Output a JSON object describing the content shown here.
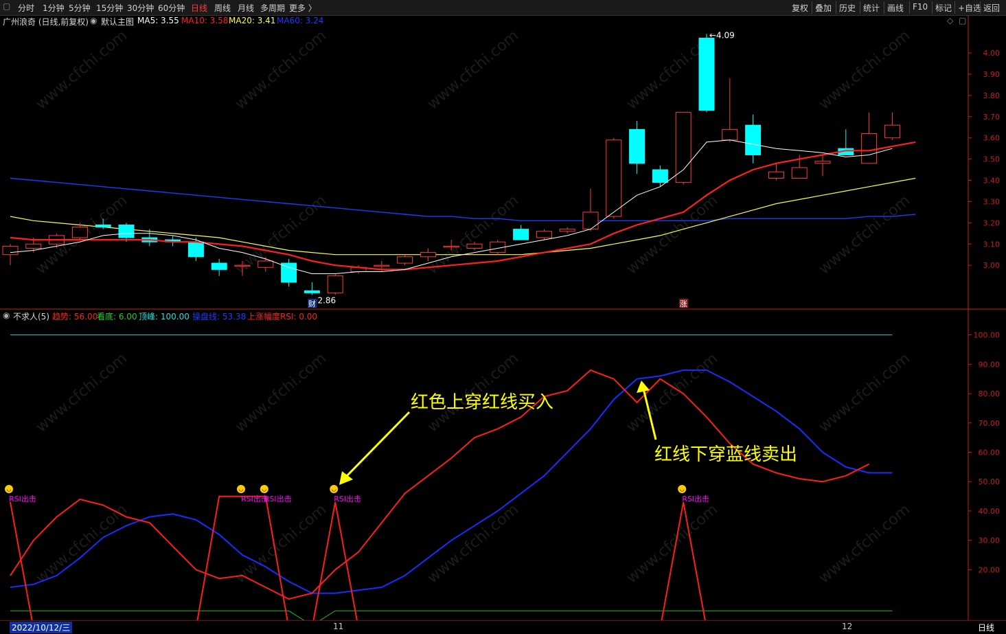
{
  "toolbar": {
    "left": [
      "分时",
      "1分钟",
      "5分钟",
      "15分钟",
      "30分钟",
      "60分钟",
      "日线",
      "周线",
      "月线",
      "多周期",
      "更多 〉"
    ],
    "active": "日线",
    "right": [
      "复权",
      "叠加",
      "历史",
      "统计",
      "画线",
      "F10",
      "标记",
      "+自选",
      "返回"
    ]
  },
  "main_header": {
    "stock": "广州浪奇 (日线,前复权)",
    "template": "默认主图",
    "ma5": "MA5: 3.55",
    "ma10": "MA10: 3.58",
    "ma20": "MA20: 3.41",
    "ma60": "MA60: 3.24"
  },
  "indicator_header": {
    "name": "不求人(5)",
    "trend": "趋势: 56.00",
    "bottom": "看底: 6.00",
    "top": "顶峰: 100.00",
    "swing": "操盘线: 53.38",
    "rsi": "上涨幅度RSI: 0.00"
  },
  "annotations": {
    "buy": "红色上穿红线买入",
    "sell": "红线下穿蓝线卖出",
    "rsi_signal": "RSI出击",
    "high_label": "4.09",
    "low_label": "2.86",
    "marker_cai": "财",
    "marker_zhang": "涨"
  },
  "bottom": {
    "date": "2022/10/12/三",
    "month11": "11",
    "month12": "12",
    "period": "日线"
  },
  "colors": {
    "up": "#ff3b3b",
    "down": "#00ffff",
    "ma5": "#ffffff",
    "ma10": "#ff2020",
    "ma20": "#ffff40",
    "ma60": "#1a3cff",
    "axis": "#c81e1e",
    "annotation": "#ffff00",
    "rsi_text": "#ff00ff"
  },
  "chart_data": [
    {
      "type": "candlestick",
      "title": "广州浪奇 (日线,前复权)",
      "y_ticks": [
        3.0,
        3.1,
        3.2,
        3.3,
        3.4,
        3.5,
        3.6,
        3.7,
        3.8,
        3.9,
        4.0
      ],
      "ylim": [
        2.8,
        4.12
      ],
      "candles": [
        {
          "o": 3.05,
          "h": 3.1,
          "l": 3.0,
          "c": 3.09
        },
        {
          "o": 3.08,
          "h": 3.13,
          "l": 3.06,
          "c": 3.1
        },
        {
          "o": 3.1,
          "h": 3.15,
          "l": 3.08,
          "c": 3.14
        },
        {
          "o": 3.13,
          "h": 3.2,
          "l": 3.12,
          "c": 3.18
        },
        {
          "o": 3.19,
          "h": 3.22,
          "l": 3.17,
          "c": 3.18
        },
        {
          "o": 3.19,
          "h": 3.2,
          "l": 3.11,
          "c": 3.13
        },
        {
          "o": 3.13,
          "h": 3.17,
          "l": 3.09,
          "c": 3.11
        },
        {
          "o": 3.12,
          "h": 3.14,
          "l": 3.09,
          "c": 3.11
        },
        {
          "o": 3.11,
          "h": 3.13,
          "l": 3.02,
          "c": 3.04
        },
        {
          "o": 3.01,
          "h": 3.03,
          "l": 2.95,
          "c": 2.98
        },
        {
          "o": 3.0,
          "h": 3.02,
          "l": 2.95,
          "c": 3.0
        },
        {
          "o": 2.99,
          "h": 3.04,
          "l": 2.97,
          "c": 3.02
        },
        {
          "o": 3.01,
          "h": 3.03,
          "l": 2.9,
          "c": 2.92
        },
        {
          "o": 2.88,
          "h": 2.92,
          "l": 2.86,
          "c": 2.87
        },
        {
          "o": 2.87,
          "h": 2.96,
          "l": 2.86,
          "c": 2.95
        },
        {
          "o": 2.97,
          "h": 3.0,
          "l": 2.96,
          "c": 2.99
        },
        {
          "o": 3.0,
          "h": 3.02,
          "l": 2.97,
          "c": 3.0
        },
        {
          "o": 3.01,
          "h": 3.05,
          "l": 3.0,
          "c": 3.04
        },
        {
          "o": 3.04,
          "h": 3.08,
          "l": 3.02,
          "c": 3.06
        },
        {
          "o": 3.09,
          "h": 3.12,
          "l": 3.07,
          "c": 3.09
        },
        {
          "o": 3.08,
          "h": 3.11,
          "l": 3.07,
          "c": 3.1
        },
        {
          "o": 3.06,
          "h": 3.12,
          "l": 3.05,
          "c": 3.11
        },
        {
          "o": 3.17,
          "h": 3.19,
          "l": 3.12,
          "c": 3.12
        },
        {
          "o": 3.13,
          "h": 3.17,
          "l": 3.12,
          "c": 3.16
        },
        {
          "o": 3.16,
          "h": 3.18,
          "l": 3.15,
          "c": 3.17
        },
        {
          "o": 3.17,
          "h": 3.36,
          "l": 3.16,
          "c": 3.25
        },
        {
          "o": 3.23,
          "h": 3.6,
          "l": 3.22,
          "c": 3.59
        },
        {
          "o": 3.64,
          "h": 3.68,
          "l": 3.43,
          "c": 3.48
        },
        {
          "o": 3.45,
          "h": 3.47,
          "l": 3.37,
          "c": 3.39
        },
        {
          "o": 3.39,
          "h": 3.72,
          "l": 3.38,
          "c": 3.72
        },
        {
          "o": 4.07,
          "h": 4.09,
          "l": 3.72,
          "c": 3.73
        },
        {
          "o": 3.59,
          "h": 3.88,
          "l": 3.58,
          "c": 3.64
        },
        {
          "o": 3.66,
          "h": 3.71,
          "l": 3.48,
          "c": 3.52
        },
        {
          "o": 3.41,
          "h": 3.48,
          "l": 3.4,
          "c": 3.44
        },
        {
          "o": 3.41,
          "h": 3.52,
          "l": 3.41,
          "c": 3.46
        },
        {
          "o": 3.48,
          "h": 3.52,
          "l": 3.42,
          "c": 3.49
        },
        {
          "o": 3.55,
          "h": 3.64,
          "l": 3.53,
          "c": 3.52
        },
        {
          "o": 3.48,
          "h": 3.72,
          "l": 3.48,
          "c": 3.62
        },
        {
          "o": 3.6,
          "h": 3.72,
          "l": 3.59,
          "c": 3.66
        }
      ],
      "ma5": [
        3.06,
        3.07,
        3.09,
        3.11,
        3.14,
        3.15,
        3.15,
        3.14,
        3.12,
        3.08,
        3.06,
        3.03,
        2.99,
        2.96,
        2.96,
        2.97,
        2.97,
        2.98,
        3.01,
        3.04,
        3.06,
        3.08,
        3.1,
        3.12,
        3.14,
        3.17,
        3.25,
        3.33,
        3.37,
        3.45,
        3.58,
        3.59,
        3.57,
        3.55,
        3.54,
        3.53,
        3.51,
        3.52,
        3.55
      ],
      "ma10": [
        3.13,
        3.12,
        3.12,
        3.12,
        3.12,
        3.12,
        3.12,
        3.11,
        3.11,
        3.1,
        3.09,
        3.07,
        3.05,
        3.02,
        3.0,
        2.99,
        2.98,
        2.98,
        2.99,
        3.0,
        3.01,
        3.02,
        3.04,
        3.06,
        3.08,
        3.1,
        3.15,
        3.19,
        3.22,
        3.25,
        3.33,
        3.4,
        3.45,
        3.48,
        3.5,
        3.52,
        3.54,
        3.54,
        3.56,
        3.58
      ],
      "ma20": [
        3.23,
        3.21,
        3.2,
        3.19,
        3.18,
        3.17,
        3.16,
        3.15,
        3.14,
        3.13,
        3.11,
        3.09,
        3.07,
        3.06,
        3.05,
        3.05,
        3.05,
        3.05,
        3.05,
        3.05,
        3.05,
        3.05,
        3.05,
        3.06,
        3.07,
        3.08,
        3.1,
        3.12,
        3.14,
        3.17,
        3.2,
        3.23,
        3.26,
        3.29,
        3.31,
        3.33,
        3.35,
        3.37,
        3.39,
        3.41
      ],
      "ma60": [
        3.41,
        3.4,
        3.39,
        3.38,
        3.37,
        3.36,
        3.35,
        3.34,
        3.33,
        3.32,
        3.31,
        3.3,
        3.29,
        3.28,
        3.27,
        3.26,
        3.25,
        3.24,
        3.23,
        3.23,
        3.22,
        3.22,
        3.21,
        3.21,
        3.21,
        3.21,
        3.21,
        3.21,
        3.21,
        3.21,
        3.21,
        3.22,
        3.22,
        3.22,
        3.22,
        3.22,
        3.22,
        3.23,
        3.23,
        3.24
      ]
    },
    {
      "type": "line",
      "title": "不求人(5)",
      "y_ticks": [
        20,
        30,
        40,
        50,
        60,
        70,
        80,
        90,
        100
      ],
      "ylim": [
        3,
        106
      ],
      "top_line": 100,
      "bottom_line": 6,
      "red": [
        18,
        30,
        38,
        44,
        42,
        38,
        36,
        28,
        20,
        17,
        18,
        14,
        10,
        12,
        20,
        26,
        36,
        46,
        52,
        58,
        65,
        68,
        72,
        79,
        81,
        88,
        85,
        77,
        85,
        80,
        72,
        63,
        56,
        53,
        51,
        50,
        52,
        56
      ],
      "blue": [
        14,
        15,
        18,
        24,
        31,
        35,
        38,
        39,
        37,
        32,
        25,
        21,
        16,
        12,
        12,
        13,
        14,
        18,
        24,
        30,
        35,
        40,
        46,
        52,
        60,
        68,
        78,
        85,
        86,
        88,
        88,
        84,
        79,
        74,
        68,
        60,
        55,
        53,
        53
      ],
      "rsi": [
        43,
        0,
        0,
        0,
        0,
        0,
        0,
        0,
        0,
        45,
        45,
        45,
        0,
        0,
        43,
        0,
        0,
        0,
        0,
        0,
        0,
        0,
        0,
        0,
        0,
        0,
        0,
        0,
        0,
        43,
        0,
        0,
        0,
        0,
        0,
        0,
        0,
        0
      ],
      "green": [
        6,
        6,
        6,
        6,
        6,
        6,
        6,
        6,
        6,
        6,
        6,
        6,
        6,
        1,
        6,
        6,
        6,
        6,
        6,
        6,
        6,
        6,
        6,
        6,
        6,
        6,
        6,
        6,
        6,
        6,
        6,
        6,
        6,
        6,
        6,
        6,
        6,
        6,
        6
      ]
    }
  ]
}
